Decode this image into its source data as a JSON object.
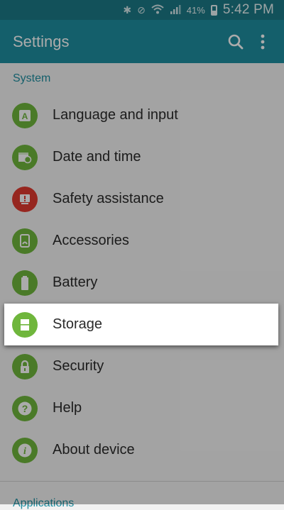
{
  "status_bar": {
    "battery_percent": "41%",
    "time": "5:42 PM",
    "icons": [
      "bluetooth-icon",
      "vibrate-mute-icon",
      "wifi-icon",
      "signal-icon",
      "battery-icon"
    ]
  },
  "app_bar": {
    "title": "Settings",
    "search_icon": "search-icon",
    "overflow_icon": "more-vertical-icon"
  },
  "sections": {
    "system_label": "System",
    "next_label": "Applications"
  },
  "items": [
    {
      "label": "Language and input",
      "icon": "language-icon",
      "color": "#6fb63c"
    },
    {
      "label": "Date and time",
      "icon": "calendar-clock-icon",
      "color": "#6fb63c"
    },
    {
      "label": "Safety assistance",
      "icon": "safety-alert-icon",
      "color": "#e03a2f"
    },
    {
      "label": "Accessories",
      "icon": "accessories-icon",
      "color": "#6fb63c"
    },
    {
      "label": "Battery",
      "icon": "battery-icon",
      "color": "#6fb63c"
    },
    {
      "label": "Storage",
      "icon": "storage-card-icon",
      "color": "#6fb63c",
      "selected": true
    },
    {
      "label": "Security",
      "icon": "lock-icon",
      "color": "#6fb63c"
    },
    {
      "label": "Help",
      "icon": "help-icon",
      "color": "#6fb63c"
    },
    {
      "label": "About device",
      "icon": "info-icon",
      "color": "#6fb63c"
    }
  ],
  "colors": {
    "accent": "#1f8ea0",
    "status_bar": "#1b7a86",
    "green_icon": "#6fb63c",
    "red_icon": "#e03a2f"
  }
}
